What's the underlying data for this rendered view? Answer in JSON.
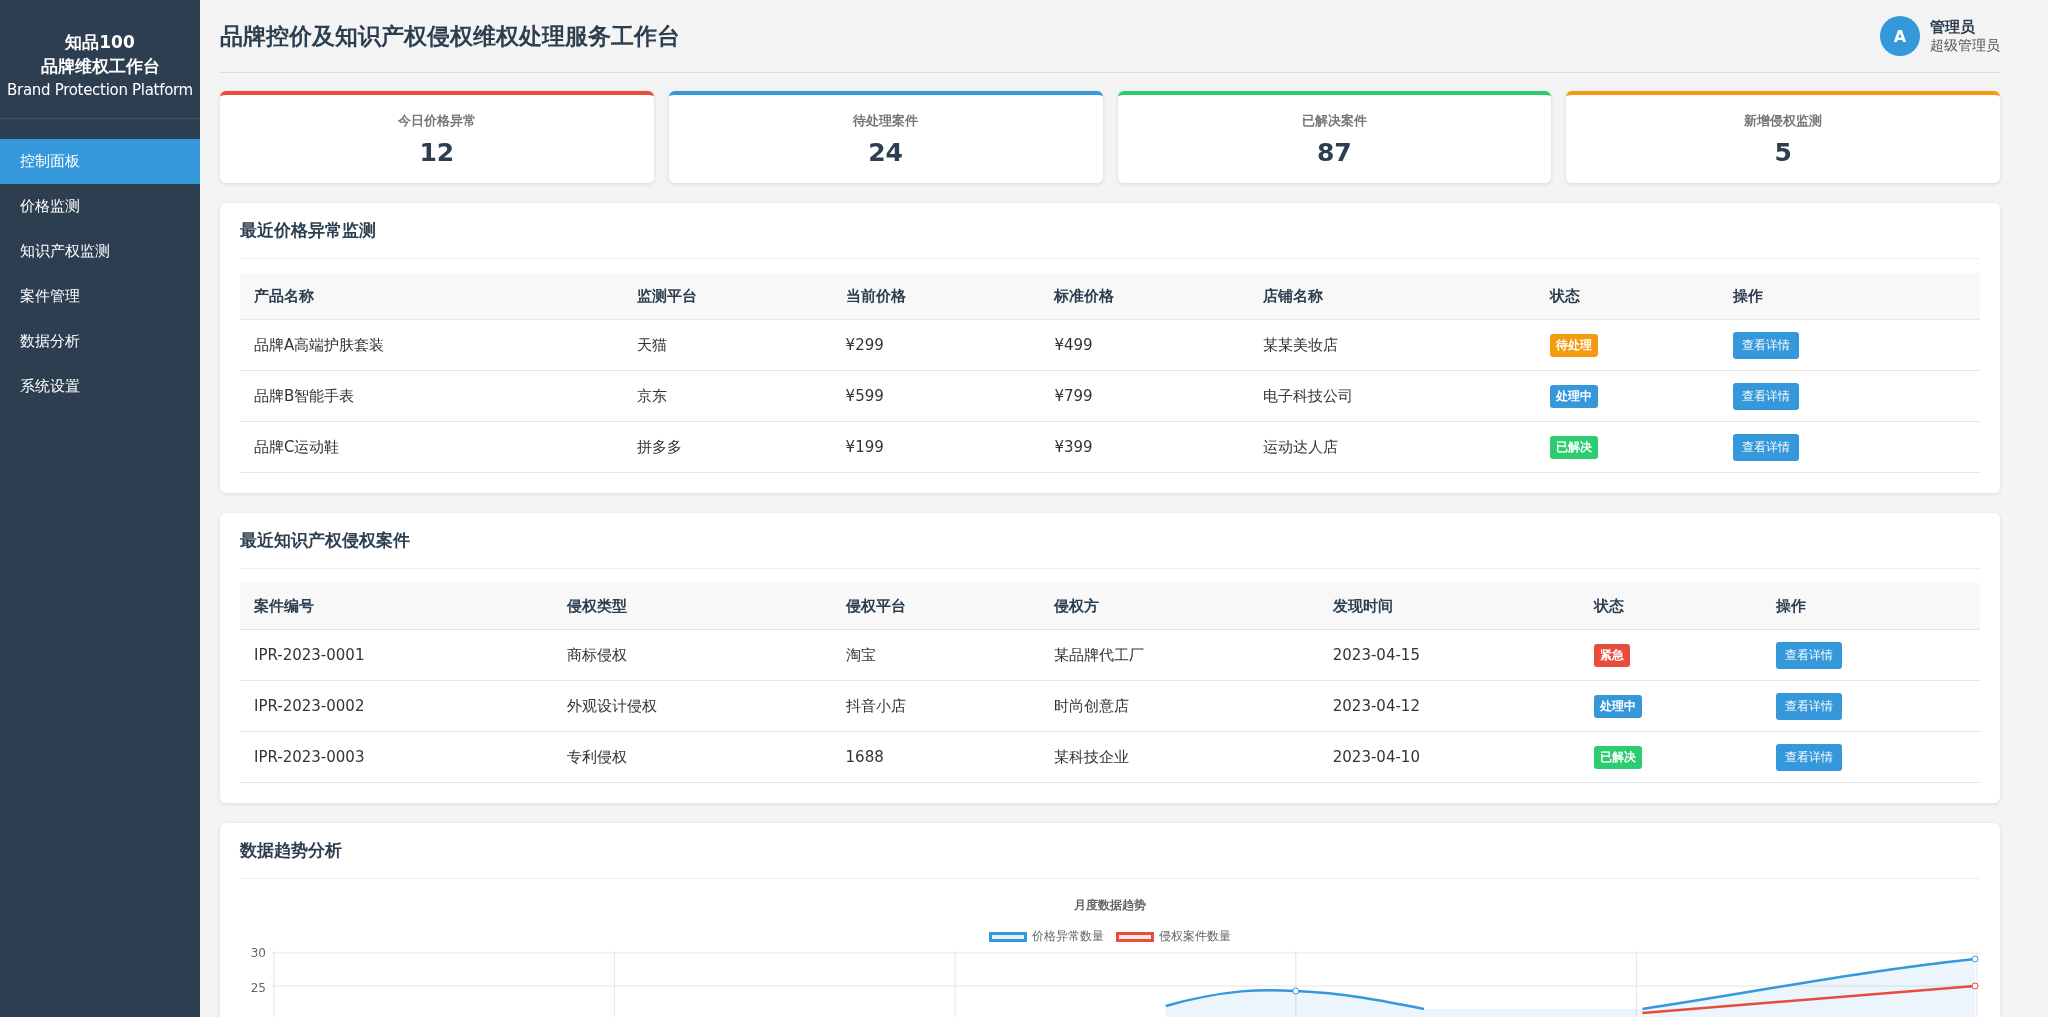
{
  "sidebar": {
    "logo_lines": [
      "知品100",
      "品牌维权工作台"
    ],
    "subtitle": "Brand Protection Platform",
    "items": [
      {
        "label": "控制面板",
        "selected": true
      },
      {
        "label": "价格监测",
        "selected": false
      },
      {
        "label": "知识产权监测",
        "selected": false
      },
      {
        "label": "案件管理",
        "selected": false
      },
      {
        "label": "数据分析",
        "selected": false
      },
      {
        "label": "系统设置",
        "selected": false
      }
    ]
  },
  "header": {
    "title": "品牌控价及知识产权侵权维权处理服务工作台",
    "user": {
      "avatar": "A",
      "name": "管理员",
      "role": "超级管理员"
    }
  },
  "stats": [
    {
      "label": "今日价格异常",
      "value": "12",
      "color": "#e74c3c"
    },
    {
      "label": "待处理案件",
      "value": "24",
      "color": "#3498db"
    },
    {
      "label": "已解决案件",
      "value": "87",
      "color": "#2ecc71"
    },
    {
      "label": "新增侵权监测",
      "value": "5",
      "color": "#f39c12"
    }
  ],
  "price_table": {
    "title": "最近价格异常监测",
    "columns": [
      "产品名称",
      "监测平台",
      "当前价格",
      "标准价格",
      "店铺名称",
      "状态",
      "操作"
    ],
    "rows": [
      {
        "cells": [
          "品牌A高端护肤套装",
          "天猫",
          "¥299",
          "¥499",
          "某某美妆店"
        ],
        "status": {
          "label": "待处理",
          "color": "#f39c12"
        },
        "action": "查看详情"
      },
      {
        "cells": [
          "品牌B智能手表",
          "京东",
          "¥599",
          "¥799",
          "电子科技公司"
        ],
        "status": {
          "label": "处理中",
          "color": "#3498db"
        },
        "action": "查看详情"
      },
      {
        "cells": [
          "品牌C运动鞋",
          "拼多多",
          "¥199",
          "¥399",
          "运动达人店"
        ],
        "status": {
          "label": "已解决",
          "color": "#2ecc71"
        },
        "action": "查看详情"
      }
    ]
  },
  "ip_table": {
    "title": "最近知识产权侵权案件",
    "columns": [
      "案件编号",
      "侵权类型",
      "侵权平台",
      "侵权方",
      "发现时间",
      "状态",
      "操作"
    ],
    "rows": [
      {
        "cells": [
          "IPR-2023-0001",
          "商标侵权",
          "淘宝",
          "某品牌代工厂",
          "2023-04-15"
        ],
        "status": {
          "label": "紧急",
          "color": "#e74c3c"
        },
        "action": "查看详情"
      },
      {
        "cells": [
          "IPR-2023-0002",
          "外观设计侵权",
          "抖音小店",
          "时尚创意店",
          "2023-04-12"
        ],
        "status": {
          "label": "处理中",
          "color": "#3498db"
        },
        "action": "查看详情"
      },
      {
        "cells": [
          "IPR-2023-0003",
          "专利侵权",
          "1688",
          "某科技企业",
          "2023-04-10"
        ],
        "status": {
          "label": "已解决",
          "color": "#2ecc71"
        },
        "action": "查看详情"
      }
    ]
  },
  "trend": {
    "title": "数据趋势分析",
    "chart_title": "月度数据趋势",
    "legend": [
      {
        "label": "价格异常数量",
        "color": "#3498db"
      },
      {
        "label": "侵权案件数量",
        "color": "#e74c3c"
      }
    ],
    "y_ticks": [
      "30",
      "25"
    ]
  }
}
